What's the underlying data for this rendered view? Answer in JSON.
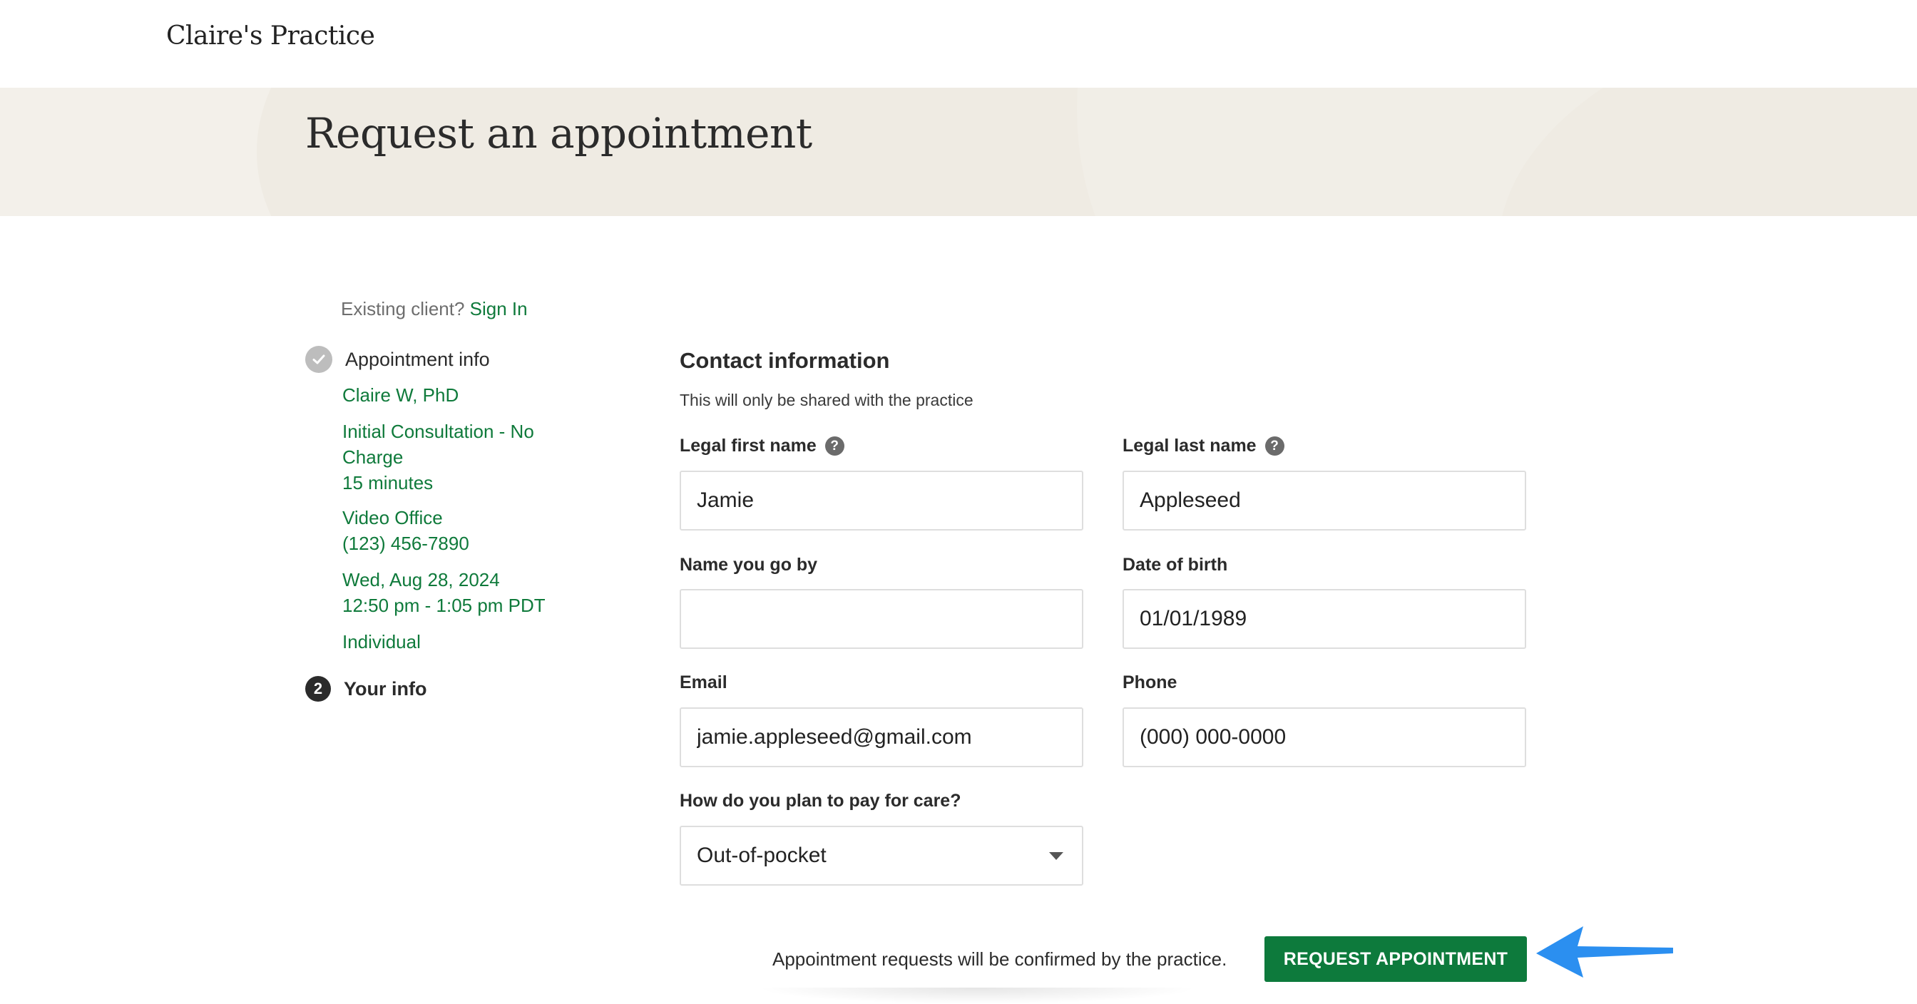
{
  "header": {
    "practice_name": "Claire's Practice"
  },
  "hero": {
    "title": "Request an appointment"
  },
  "sidebar": {
    "existing_client_text": "Existing client?",
    "sign_in_link": "Sign In",
    "step1_label": "Appointment info",
    "clinician": "Claire W, PhD",
    "service_line1": "Initial Consultation - No",
    "service_line2": "Charge",
    "duration": "15 minutes",
    "location": "Video Office",
    "phone": "(123) 456-7890",
    "date": "Wed, Aug 28, 2024",
    "time": "12:50 pm - 1:05 pm PDT",
    "client_type": "Individual",
    "step2_number": "2",
    "step2_label": "Your info"
  },
  "form": {
    "section_title": "Contact information",
    "section_subtitle": "This will only be shared with the practice",
    "first_name_label": "Legal first name",
    "first_name_value": "Jamie",
    "last_name_label": "Legal last name",
    "last_name_value": "Appleseed",
    "preferred_name_label": "Name you go by",
    "preferred_name_value": "",
    "dob_label": "Date of birth",
    "dob_value": "01/01/1989",
    "email_label": "Email",
    "email_value": "jamie.appleseed@gmail.com",
    "phone_label": "Phone",
    "phone_value": "(000) 000-0000",
    "payment_label": "How do you plan to pay for care?",
    "payment_value": "Out-of-pocket",
    "help_glyph": "?"
  },
  "footer": {
    "confirm_note": "Appointment requests will be confirmed by the practice.",
    "request_button": "REQUEST APPOINTMENT"
  },
  "colors": {
    "brand_green": "#0d7a3c",
    "link_green": "#0f7a3b",
    "hero_bg": "#f3f0ea",
    "annotation_arrow": "#2b8ff0"
  },
  "icons": {
    "step1": "check-circle-icon",
    "help": "question-circle-icon",
    "select": "caret-down-icon",
    "annotation": "arrow-left-icon"
  }
}
